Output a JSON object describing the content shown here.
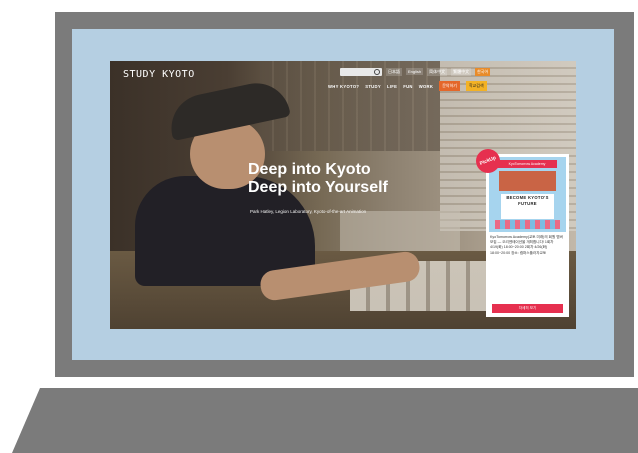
{
  "site": {
    "brand": "STUDY KYOTO",
    "topbar": {
      "search_placeholder": "",
      "languages": [
        "日本語",
        "English",
        "简体中文",
        "繁體中文",
        "한국어"
      ],
      "active_language": "한국어"
    },
    "nav": {
      "items": [
        "WHY KYOTO?",
        "STUDY",
        "LIFE",
        "FUN",
        "WORK"
      ],
      "contact_label": "문의하기",
      "search_label": "학교검색"
    },
    "hero": {
      "line1": "Deep into Kyoto",
      "line2": "Deep into Yourself",
      "subtitle": "Park Hatley, Legion Laboratory, Kyoto-of-the-art Animation"
    },
    "pickup": {
      "badge": "PickUp",
      "poster_banner": "KyoTomorrow Academy",
      "poster_title": "BECOME KYOTO'S FUTURE",
      "body": "KyoTomorrow Academy(교토 미래)의 회원 멤버 모집 — 오리엔테이션을 개최합니다! 1회차 4/19(화) 18:00~20:00 2회차 4/26(화) 18:00~20:00 장소: 캠퍼스플라자교토",
      "button": "자세히 보기"
    },
    "colors": {
      "lid": "#7b7b7b",
      "bezel": "#b5cfe2",
      "base": "#7b7b7b",
      "accent_orange": "#e4672a",
      "accent_yellow": "#f3b225",
      "pickup_red": "#e6304f"
    }
  }
}
